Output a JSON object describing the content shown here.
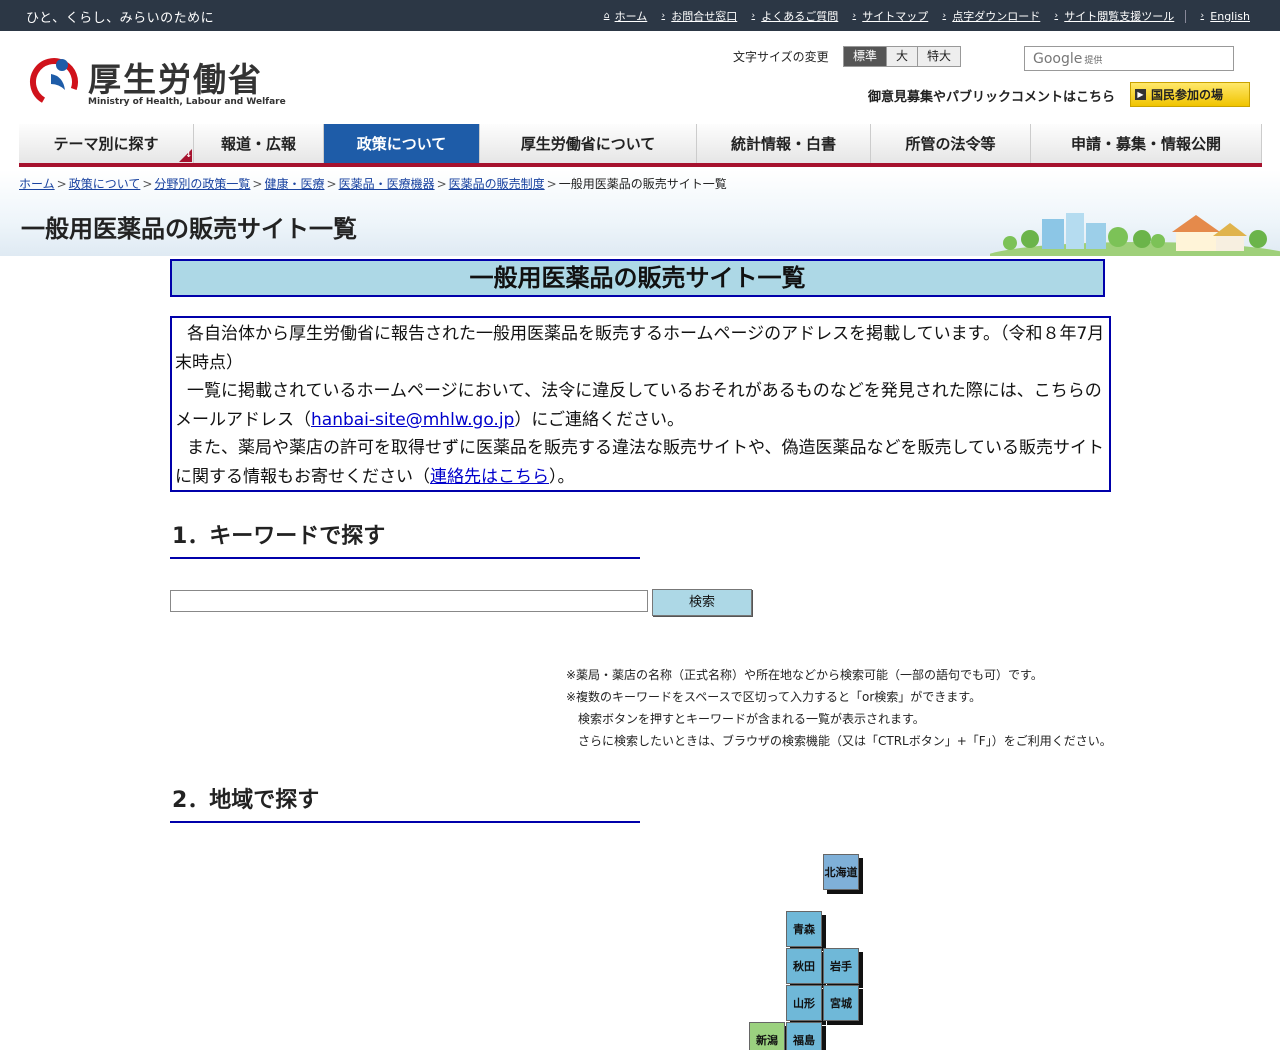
{
  "topbar": {
    "tagline": "ひと、くらし、みらいのために",
    "links": [
      {
        "label": "ホーム",
        "icon": "home-icon"
      },
      {
        "label": "お問合せ窓口",
        "icon": "arrow-right-icon"
      },
      {
        "label": "よくあるご質問",
        "icon": "arrow-right-icon"
      },
      {
        "label": "サイトマップ",
        "icon": "arrow-right-icon"
      },
      {
        "label": "点字ダウンロード",
        "icon": "arrow-right-icon"
      },
      {
        "label": "サイト閲覧支援ツール",
        "icon": "arrow-right-icon"
      },
      {
        "label": "English",
        "icon": "arrow-right-icon"
      }
    ]
  },
  "header": {
    "logo_text": "厚生労働省",
    "logo_sub": "Ministry of Health, Labour and Welfare",
    "font_size_label": "文字サイズの変更",
    "font_sizes": [
      "標準",
      "大",
      "特大"
    ],
    "search_brand": "Google",
    "search_provided": "提供",
    "opinion_link": "御意見募集やパブリックコメントはこちら",
    "kokumin_button": "国民参加の場"
  },
  "nav": {
    "items": [
      {
        "label": "テーマ別に探す",
        "width": 175,
        "active": false,
        "dropdown": true
      },
      {
        "label": "報道・広報",
        "width": 130,
        "active": false,
        "dropdown": false
      },
      {
        "label": "政策について",
        "width": 156,
        "active": true,
        "dropdown": false
      },
      {
        "label": "厚生労働省について",
        "width": 217,
        "active": false,
        "dropdown": false
      },
      {
        "label": "統計情報・白書",
        "width": 174,
        "active": false,
        "dropdown": false
      },
      {
        "label": "所管の法令等",
        "width": 160,
        "active": false,
        "dropdown": false
      },
      {
        "label": "申請・募集・情報公開",
        "width": 231,
        "active": false,
        "dropdown": false
      }
    ]
  },
  "breadcrumb": {
    "links": [
      "ホーム",
      "政策について",
      "分野別の政策一覧",
      "健康・医療",
      "医薬品・医療機器",
      "医薬品の販売制度"
    ],
    "current": "一般用医薬品の販売サイト一覧"
  },
  "page_title": "一般用医薬品の販売サイト一覧",
  "main": {
    "title": "一般用医薬品の販売サイト一覧",
    "notice": {
      "p1": "各自治体から厚生労働省に報告された一般用医薬品を販売するホームページのアドレスを掲載しています。（令和８年7月末時点）",
      "p2_a": "一覧に掲載されているホームページにおいて、法令に違反しているおそれがあるものなどを発見された際には、こちらのメールアドレス（",
      "p2_email": "hanbai-site@mhlw.go.jp",
      "p2_b": "）にご連絡ください。",
      "p3_a": "また、薬局や薬店の許可を取得せずに医薬品を販売する違法な販売サイトや、偽造医薬品などを販売している販売サイトに関する情報もお寄せください（",
      "p3_link": "連絡先はこちら",
      "p3_b": "）。"
    },
    "section1_title": "1．キーワードで探す",
    "search_value": "",
    "search_button": "検索",
    "hints": [
      "※薬局・薬店の名称（正式名称）や所在地などから検索可能（一部の語句でも可）です。",
      "※複数のキーワードをスペースで区切って入力すると「or検索」ができます。",
      "検索ボタンを押すとキーワードが含まれる一覧が表示されます。",
      "さらに検索したいときは、ブラウザの検索機能（又は「CTRLボタン」+「F」）をご利用ください。"
    ],
    "section2_title": "2．地域で探す",
    "prefectures": [
      "北海道",
      "青森",
      "秋田",
      "岩手",
      "山形",
      "宮城",
      "新潟",
      "福島"
    ]
  },
  "colors": {
    "topbar": "#2c3745",
    "nav_active": "#1e5ca8",
    "nav_accent": "#a6122e",
    "title_bg": "#add8e6",
    "box_border": "#0000aa"
  }
}
